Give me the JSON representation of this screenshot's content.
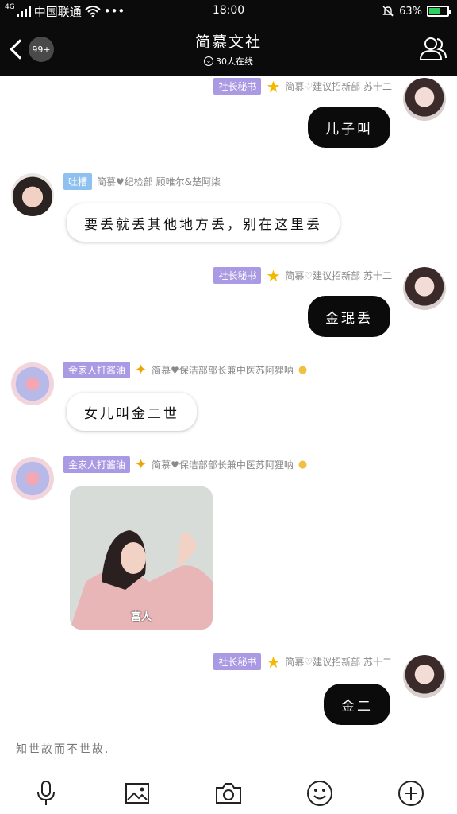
{
  "status_bar": {
    "network": "4G",
    "carrier": "中国联通",
    "more": "•••",
    "time": "18:00",
    "battery": "63%",
    "battery_level": 0.63
  },
  "header": {
    "unread": "99+",
    "title": "简慕文社",
    "online": "30人在线"
  },
  "messages": [
    {
      "tag": "社长秘书",
      "sender": "简慕♡建议招新部 苏十二",
      "text": "儿子叫"
    },
    {
      "tag": "吐槽",
      "sender": "简慕♥纪检部 顾唯尔&楚阿柒",
      "text": "要丢就丢其他地方丢，别在这里丢"
    },
    {
      "tag": "社长秘书",
      "sender": "简慕♡建议招新部 苏十二",
      "text": "金珉丢"
    },
    {
      "tag": "金家人打酱油",
      "sender": "简慕♥保洁部部长兼中医苏阿狸呐",
      "text": "女儿叫金二世"
    },
    {
      "tag": "金家人打酱油",
      "sender": "简慕♥保洁部部长兼中医苏阿狸呐",
      "image_caption": "富人"
    },
    {
      "tag": "社长秘书",
      "sender": "简慕♡建议招新部 苏十二",
      "text": "金二"
    }
  ],
  "input": {
    "text": "知世故而不世故."
  },
  "icons": {
    "voice": "microphone-icon",
    "image": "image-icon",
    "camera": "camera-icon",
    "emoji": "emoji-icon",
    "more": "plus-icon"
  },
  "colors": {
    "bar": "#0b0b0b",
    "tag_purple": "#a99ae3",
    "tag_blue": "#8ec1ef",
    "star": "#f3b800"
  }
}
